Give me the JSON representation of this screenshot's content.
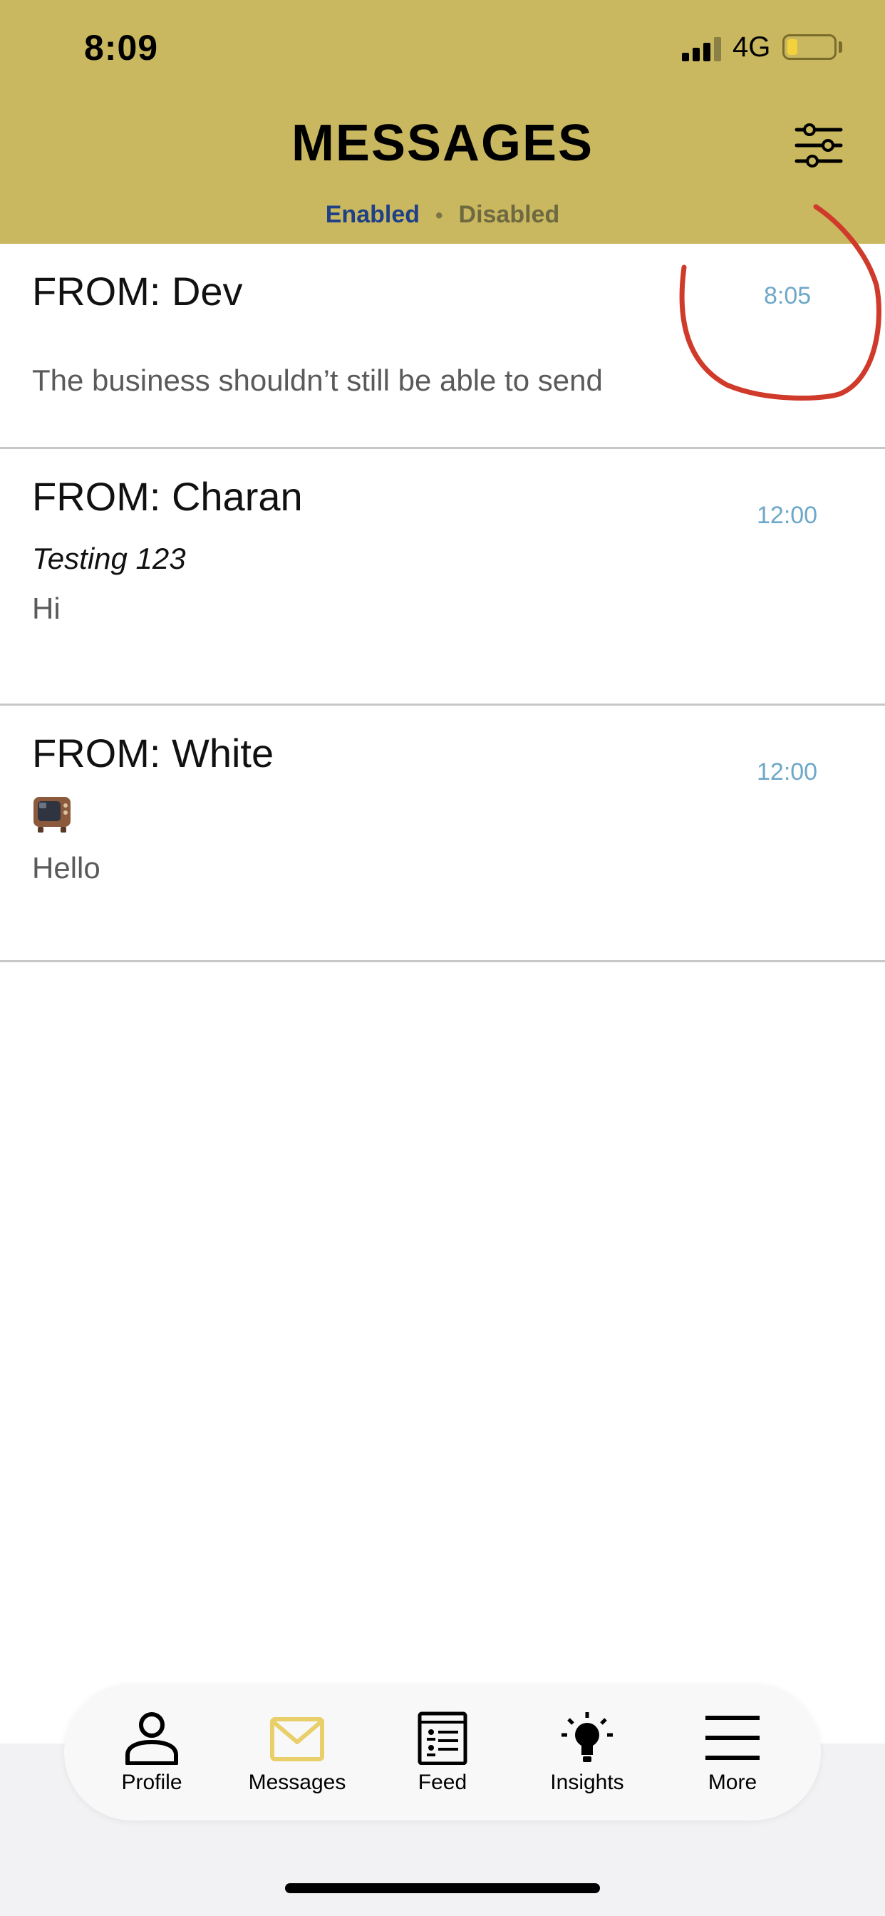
{
  "status_bar": {
    "time": "8:09",
    "network": "4G",
    "icons": [
      "signal-icon",
      "battery-low-icon"
    ]
  },
  "header": {
    "title": "MESSAGES",
    "filter_icon": "sliders-icon",
    "toggle": {
      "enabled_label": "Enabled",
      "separator": "•",
      "disabled_label": "Disabled",
      "selected": "Enabled"
    }
  },
  "messages": [
    {
      "from": "FROM: Dev",
      "time": "8:05",
      "subject": "",
      "body": "The business shouldn’t still be able to send"
    },
    {
      "from": "FROM: Charan",
      "time": "12:00",
      "subject": "Testing 123",
      "body": "Hi"
    },
    {
      "from": "FROM: White",
      "time": "12:00",
      "subject_icon": "television-icon",
      "body": "Hello"
    }
  ],
  "annotation": {
    "type": "hand-drawn-circle",
    "color": "#d03a2a"
  },
  "tab_bar": {
    "items": [
      {
        "label": "Profile",
        "icon": "person-icon",
        "active": false
      },
      {
        "label": "Messages",
        "icon": "envelope-icon",
        "active": true
      },
      {
        "label": "Feed",
        "icon": "feed-icon",
        "active": false
      },
      {
        "label": "Insights",
        "icon": "lightbulb-icon",
        "active": false
      },
      {
        "label": "More",
        "icon": "menu-icon",
        "active": false
      }
    ],
    "active_color": "#e8cf6a"
  },
  "colors": {
    "header_bg": "#c9b85f",
    "time_text": "#6ea8c9",
    "enabled_text": "#1f3f86"
  }
}
